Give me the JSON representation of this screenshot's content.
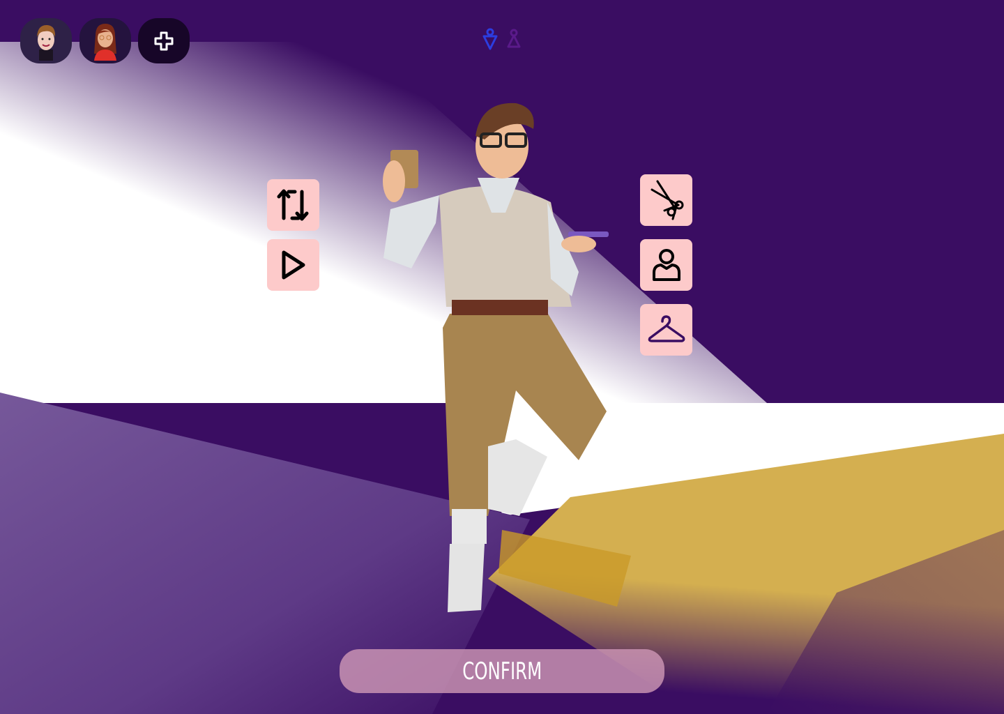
{
  "profiles": [
    {
      "name": "male-avatar",
      "icon": "boy-avatar"
    },
    {
      "name": "female-avatar",
      "icon": "girl-avatar"
    }
  ],
  "add_profile_icon": "plus-icon",
  "gender_toggle": {
    "selected": "male",
    "options": [
      "male",
      "female"
    ],
    "colors": {
      "active": "#2c3de0",
      "inactive": "#5a1a8a"
    }
  },
  "left_tools": [
    {
      "id": "swap",
      "icon": "swap-vertical-icon"
    },
    {
      "id": "play",
      "icon": "play-icon"
    }
  ],
  "right_tools": [
    {
      "id": "hair",
      "icon": "scissors-icon"
    },
    {
      "id": "body",
      "icon": "person-icon"
    },
    {
      "id": "clothes",
      "icon": "hanger-icon"
    }
  ],
  "confirm_label": "CONFIRM",
  "colors": {
    "background": "#3a0d62",
    "tool_button": "#fdcaca",
    "gold": "#d4af50",
    "confirm": "#c996b4"
  }
}
